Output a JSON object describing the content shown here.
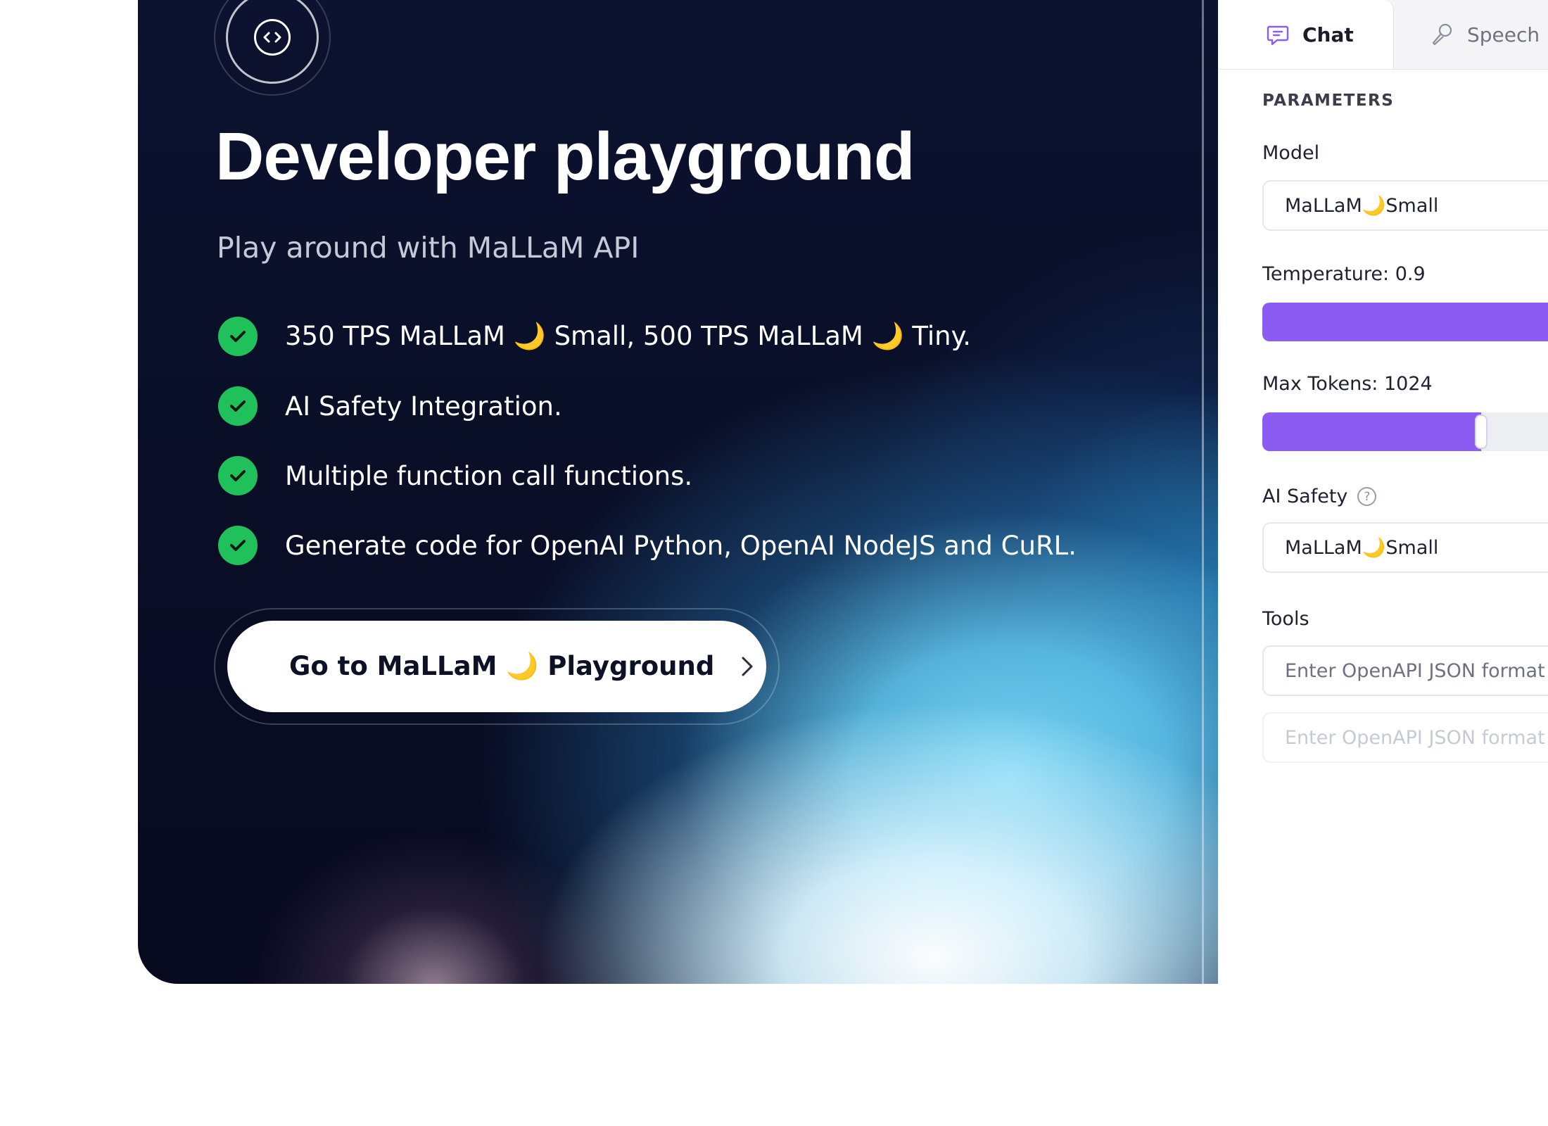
{
  "hero": {
    "title": "Developer playground",
    "subtitle": "Play around with MaLLaM API",
    "features": [
      {
        "pre": "350 TPS MaLLaM ",
        "moon": "🌙",
        "mid": " Small, 500 TPS MaLLaM ",
        "moon2": "🌙",
        "post": " Tiny."
      },
      {
        "text": "AI Safety Integration."
      },
      {
        "text": "Multiple function call functions."
      },
      {
        "text": "Generate code for OpenAI Python, OpenAI NodeJS and CuRL."
      }
    ],
    "cta": {
      "pre": "Go to MaLLaM ",
      "moon": "🌙",
      "post": " Playground"
    },
    "icon": "code-icon"
  },
  "panel": {
    "tabs": [
      {
        "label": "Chat",
        "icon": "chat-icon",
        "active": true
      },
      {
        "label": "Speech",
        "icon": "microphone-icon",
        "active": false
      }
    ],
    "parameters_heading": "PARAMETERS",
    "model": {
      "label": "Model",
      "value_pre": "MaLLaM ",
      "moon": "🌙",
      "value_post": " Small"
    },
    "temperature": {
      "label": "Temperature: 0.9",
      "value": 0.9,
      "max": 1.0
    },
    "max_tokens": {
      "label": "Max Tokens: 1024",
      "value": 1024
    },
    "ai_safety": {
      "label": "AI Safety",
      "value_pre": "MaLLaM ",
      "moon": "🌙",
      "value_post": " Small"
    },
    "tools": {
      "label": "Tools",
      "placeholders": [
        "Enter OpenAPI JSON format",
        "Enter OpenAPI JSON format"
      ]
    }
  },
  "colors": {
    "accent": "#8c5cf2",
    "check": "#20c15a",
    "hero_dark": "#0a0f28"
  }
}
